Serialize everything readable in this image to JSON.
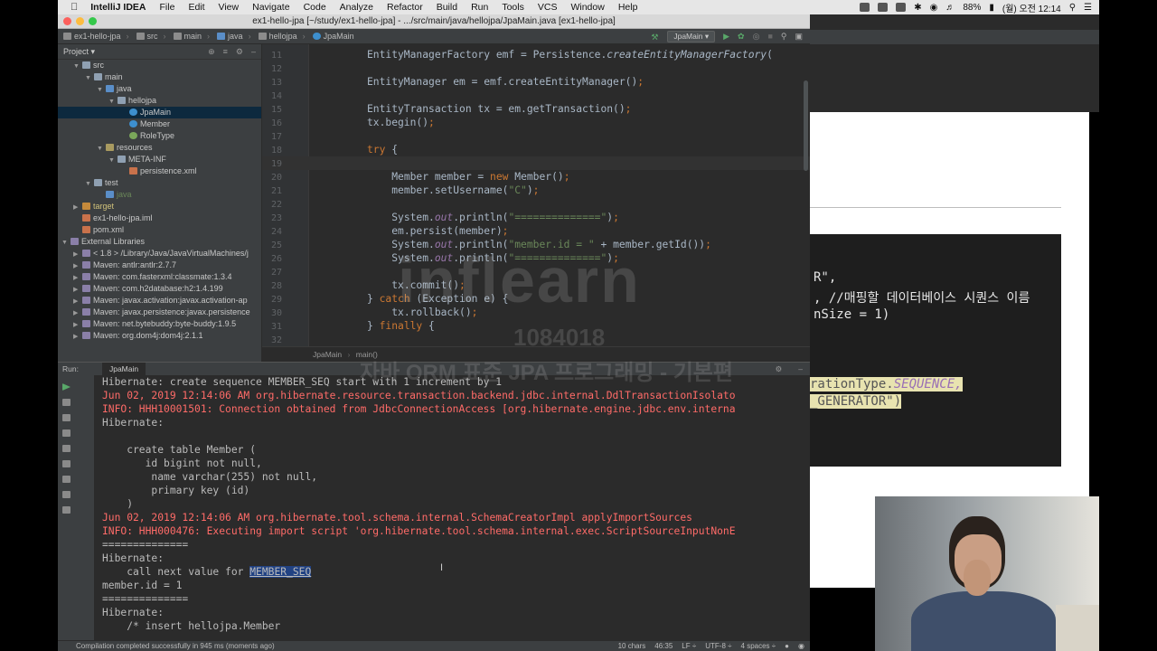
{
  "menubar": {
    "items": [
      "IntelliJ IDEA",
      "File",
      "Edit",
      "View",
      "Navigate",
      "Code",
      "Analyze",
      "Refactor",
      "Build",
      "Run",
      "Tools",
      "VCS",
      "Window",
      "Help"
    ],
    "battery": "88%",
    "clock": "(월) 오전 12:14"
  },
  "window": {
    "title": "ex1-hello-jpa [~/study/ex1-hello-jpa] - .../src/main/java/hellojpa/JpaMain.java [ex1-hello-jpa]"
  },
  "breadcrumbs": [
    "ex1-hello-jpa",
    "src",
    "main",
    "java",
    "hellojpa",
    "JpaMain"
  ],
  "run_config": "JpaMain",
  "project": {
    "header": "Project",
    "tree": [
      {
        "label": "src",
        "indent": 1,
        "arrow": "▼",
        "icon": "folder"
      },
      {
        "label": "main",
        "indent": 2,
        "arrow": "▼",
        "icon": "folder"
      },
      {
        "label": "java",
        "indent": 3,
        "arrow": "▼",
        "icon": "src"
      },
      {
        "label": "hellojpa",
        "indent": 4,
        "arrow": "▼",
        "icon": "folder"
      },
      {
        "label": "JpaMain",
        "indent": 5,
        "arrow": "",
        "icon": "class",
        "selected": true
      },
      {
        "label": "Member",
        "indent": 5,
        "arrow": "",
        "icon": "class"
      },
      {
        "label": "RoleType",
        "indent": 5,
        "arrow": "",
        "icon": "enum"
      },
      {
        "label": "resources",
        "indent": 3,
        "arrow": "▼",
        "icon": "res"
      },
      {
        "label": "META-INF",
        "indent": 4,
        "arrow": "▼",
        "icon": "folder"
      },
      {
        "label": "persistence.xml",
        "indent": 5,
        "arrow": "",
        "icon": "xml"
      },
      {
        "label": "test",
        "indent": 2,
        "arrow": "▼",
        "icon": "folder"
      },
      {
        "label": "java",
        "indent": 3,
        "arrow": "",
        "icon": "src",
        "style": "green"
      },
      {
        "label": "target",
        "indent": 1,
        "arrow": "▶",
        "icon": "target",
        "style": "yellow"
      },
      {
        "label": "ex1-hello-jpa.iml",
        "indent": 1,
        "arrow": "",
        "icon": "xml"
      },
      {
        "label": "pom.xml",
        "indent": 1,
        "arrow": "",
        "icon": "xml"
      },
      {
        "label": "External Libraries",
        "indent": 0,
        "arrow": "▼",
        "icon": "lib"
      },
      {
        "label": "< 1.8 > /Library/Java/JavaVirtualMachines/j",
        "indent": 1,
        "arrow": "▶",
        "icon": "lib"
      },
      {
        "label": "Maven: antlr:antlr:2.7.7",
        "indent": 1,
        "arrow": "▶",
        "icon": "lib"
      },
      {
        "label": "Maven: com.fasterxml:classmate:1.3.4",
        "indent": 1,
        "arrow": "▶",
        "icon": "lib"
      },
      {
        "label": "Maven: com.h2database:h2:1.4.199",
        "indent": 1,
        "arrow": "▶",
        "icon": "lib"
      },
      {
        "label": "Maven: javax.activation:javax.activation-ap",
        "indent": 1,
        "arrow": "▶",
        "icon": "lib"
      },
      {
        "label": "Maven: javax.persistence:javax.persistence",
        "indent": 1,
        "arrow": "▶",
        "icon": "lib"
      },
      {
        "label": "Maven: net.bytebuddy:byte-buddy:1.9.5",
        "indent": 1,
        "arrow": "▶",
        "icon": "lib"
      },
      {
        "label": "Maven: org.dom4j:dom4j:2.1.1",
        "indent": 1,
        "arrow": "▶",
        "icon": "lib"
      }
    ]
  },
  "editor": {
    "lines": [
      {
        "n": "11",
        "html": "<span class=\"txt\">EntityManagerFactory emf = Persistence.</span><span class=\"txt itl\">createEntityManagerFactory</span><span class=\"txt\">(</span>"
      },
      {
        "n": "12",
        "html": ""
      },
      {
        "n": "13",
        "html": "<span class=\"txt\">EntityManager em = emf.createEntityManager()</span><span class=\"kw\">;</span>"
      },
      {
        "n": "14",
        "html": ""
      },
      {
        "n": "15",
        "html": "<span class=\"txt\">EntityTransaction tx = em.getTransaction()</span><span class=\"kw\">;</span>"
      },
      {
        "n": "16",
        "html": "<span class=\"txt\">tx.begin()</span><span class=\"kw\">;</span>"
      },
      {
        "n": "17",
        "html": ""
      },
      {
        "n": "18",
        "html": "<span class=\"kw\">try </span><span class=\"txt\">{</span>"
      },
      {
        "n": "19",
        "html": "",
        "current": true
      },
      {
        "n": "20",
        "html": "    <span class=\"txt\">Member member = </span><span class=\"kw\">new </span><span class=\"txt\">Member()</span><span class=\"kw\">;</span>"
      },
      {
        "n": "21",
        "html": "    <span class=\"txt\">member.setUsername(</span><span class=\"st\">\"C\"</span><span class=\"txt\">)</span><span class=\"kw\">;</span>"
      },
      {
        "n": "22",
        "html": ""
      },
      {
        "n": "23",
        "html": "    <span class=\"txt\">System.</span><span class=\"fld\">out</span><span class=\"txt\">.println(</span><span class=\"st\">\"==============\"</span><span class=\"txt\">)</span><span class=\"kw\">;</span>"
      },
      {
        "n": "24",
        "html": "    <span class=\"txt\">em.persist(member)</span><span class=\"kw\">;</span>"
      },
      {
        "n": "25",
        "html": "    <span class=\"txt\">System.</span><span class=\"fld\">out</span><span class=\"txt\">.println(</span><span class=\"st\">\"member.id = \" </span><span class=\"txt\">+ member.getId())</span><span class=\"kw\">;</span>"
      },
      {
        "n": "26",
        "html": "    <span class=\"txt\">System.</span><span class=\"fld\">out</span><span class=\"txt\">.println(</span><span class=\"st\">\"==============\"</span><span class=\"txt\">)</span><span class=\"kw\">;</span>"
      },
      {
        "n": "27",
        "html": ""
      },
      {
        "n": "28",
        "html": "    <span class=\"txt\">tx.commit()</span><span class=\"kw\">;</span>"
      },
      {
        "n": "29",
        "html": "<span class=\"txt\">} </span><span class=\"kw\">catch </span><span class=\"txt\">(Exception e) {</span>"
      },
      {
        "n": "30",
        "html": "    <span class=\"txt\">tx.rollback()</span><span class=\"kw\">;</span>"
      },
      {
        "n": "31",
        "html": "<span class=\"txt\">} </span><span class=\"kw\">finally </span><span class=\"txt\">{</span>"
      },
      {
        "n": "32",
        "html": ""
      }
    ],
    "breadcrumb": [
      "JpaMain",
      "main()"
    ]
  },
  "run": {
    "label": "Run:",
    "tab": "JpaMain",
    "output": [
      {
        "c": "n",
        "t": "Hibernate: create sequence MEMBER_SEQ start with 1 increment by 1"
      },
      {
        "c": "r",
        "t": "Jun 02, 2019 12:14:06 AM org.hibernate.resource.transaction.backend.jdbc.internal.DdlTransactionIsolato"
      },
      {
        "c": "r",
        "t": "INFO: HHH10001501: Connection obtained from JdbcConnectionAccess [org.hibernate.engine.jdbc.env.interna"
      },
      {
        "c": "n",
        "t": "Hibernate: "
      },
      {
        "c": "n",
        "t": ""
      },
      {
        "c": "n",
        "t": "    create table Member ("
      },
      {
        "c": "n",
        "t": "       id bigint not null,"
      },
      {
        "c": "n",
        "t": "        name varchar(255) not null,"
      },
      {
        "c": "n",
        "t": "        primary key (id)"
      },
      {
        "c": "n",
        "t": "    )"
      },
      {
        "c": "r",
        "t": "Jun 02, 2019 12:14:06 AM org.hibernate.tool.schema.internal.SchemaCreatorImpl applyImportSources"
      },
      {
        "c": "r",
        "t": "INFO: HHH000476: Executing import script 'org.hibernate.tool.schema.internal.exec.ScriptSourceInputNonE"
      },
      {
        "c": "n",
        "t": "=============="
      },
      {
        "c": "n",
        "t": "Hibernate: "
      },
      {
        "c": "n",
        "t": "    call next value for ",
        "hl": "MEMBER_SEQ"
      },
      {
        "c": "n",
        "t": "member.id = 1"
      },
      {
        "c": "n",
        "t": "=============="
      },
      {
        "c": "n",
        "t": "Hibernate: "
      },
      {
        "c": "n",
        "t": "    /* insert hellojpa.Member"
      }
    ]
  },
  "status": {
    "message": "Compilation completed successfully in 945 ms (moments ago)",
    "chars": "10 chars",
    "position": "46:35",
    "line_sep": "LF ÷",
    "encoding": "UTF-8 ÷",
    "indent": "4 spaces ÷"
  },
  "slide": {
    "line1": "R\",",
    "line2": ", //매핑할 데이터베이스 시퀀스 이름",
    "line3": "nSize = 1)",
    "gen_a": "rationType.",
    "gen_b": "SEQUENCE,",
    "gen_c": "_GENERATOR\")"
  },
  "watermark": {
    "brand": "inflearn",
    "id": "1084018",
    "course": "자바 ORM 표준 JPA 프로그래밍 - 기본편"
  }
}
